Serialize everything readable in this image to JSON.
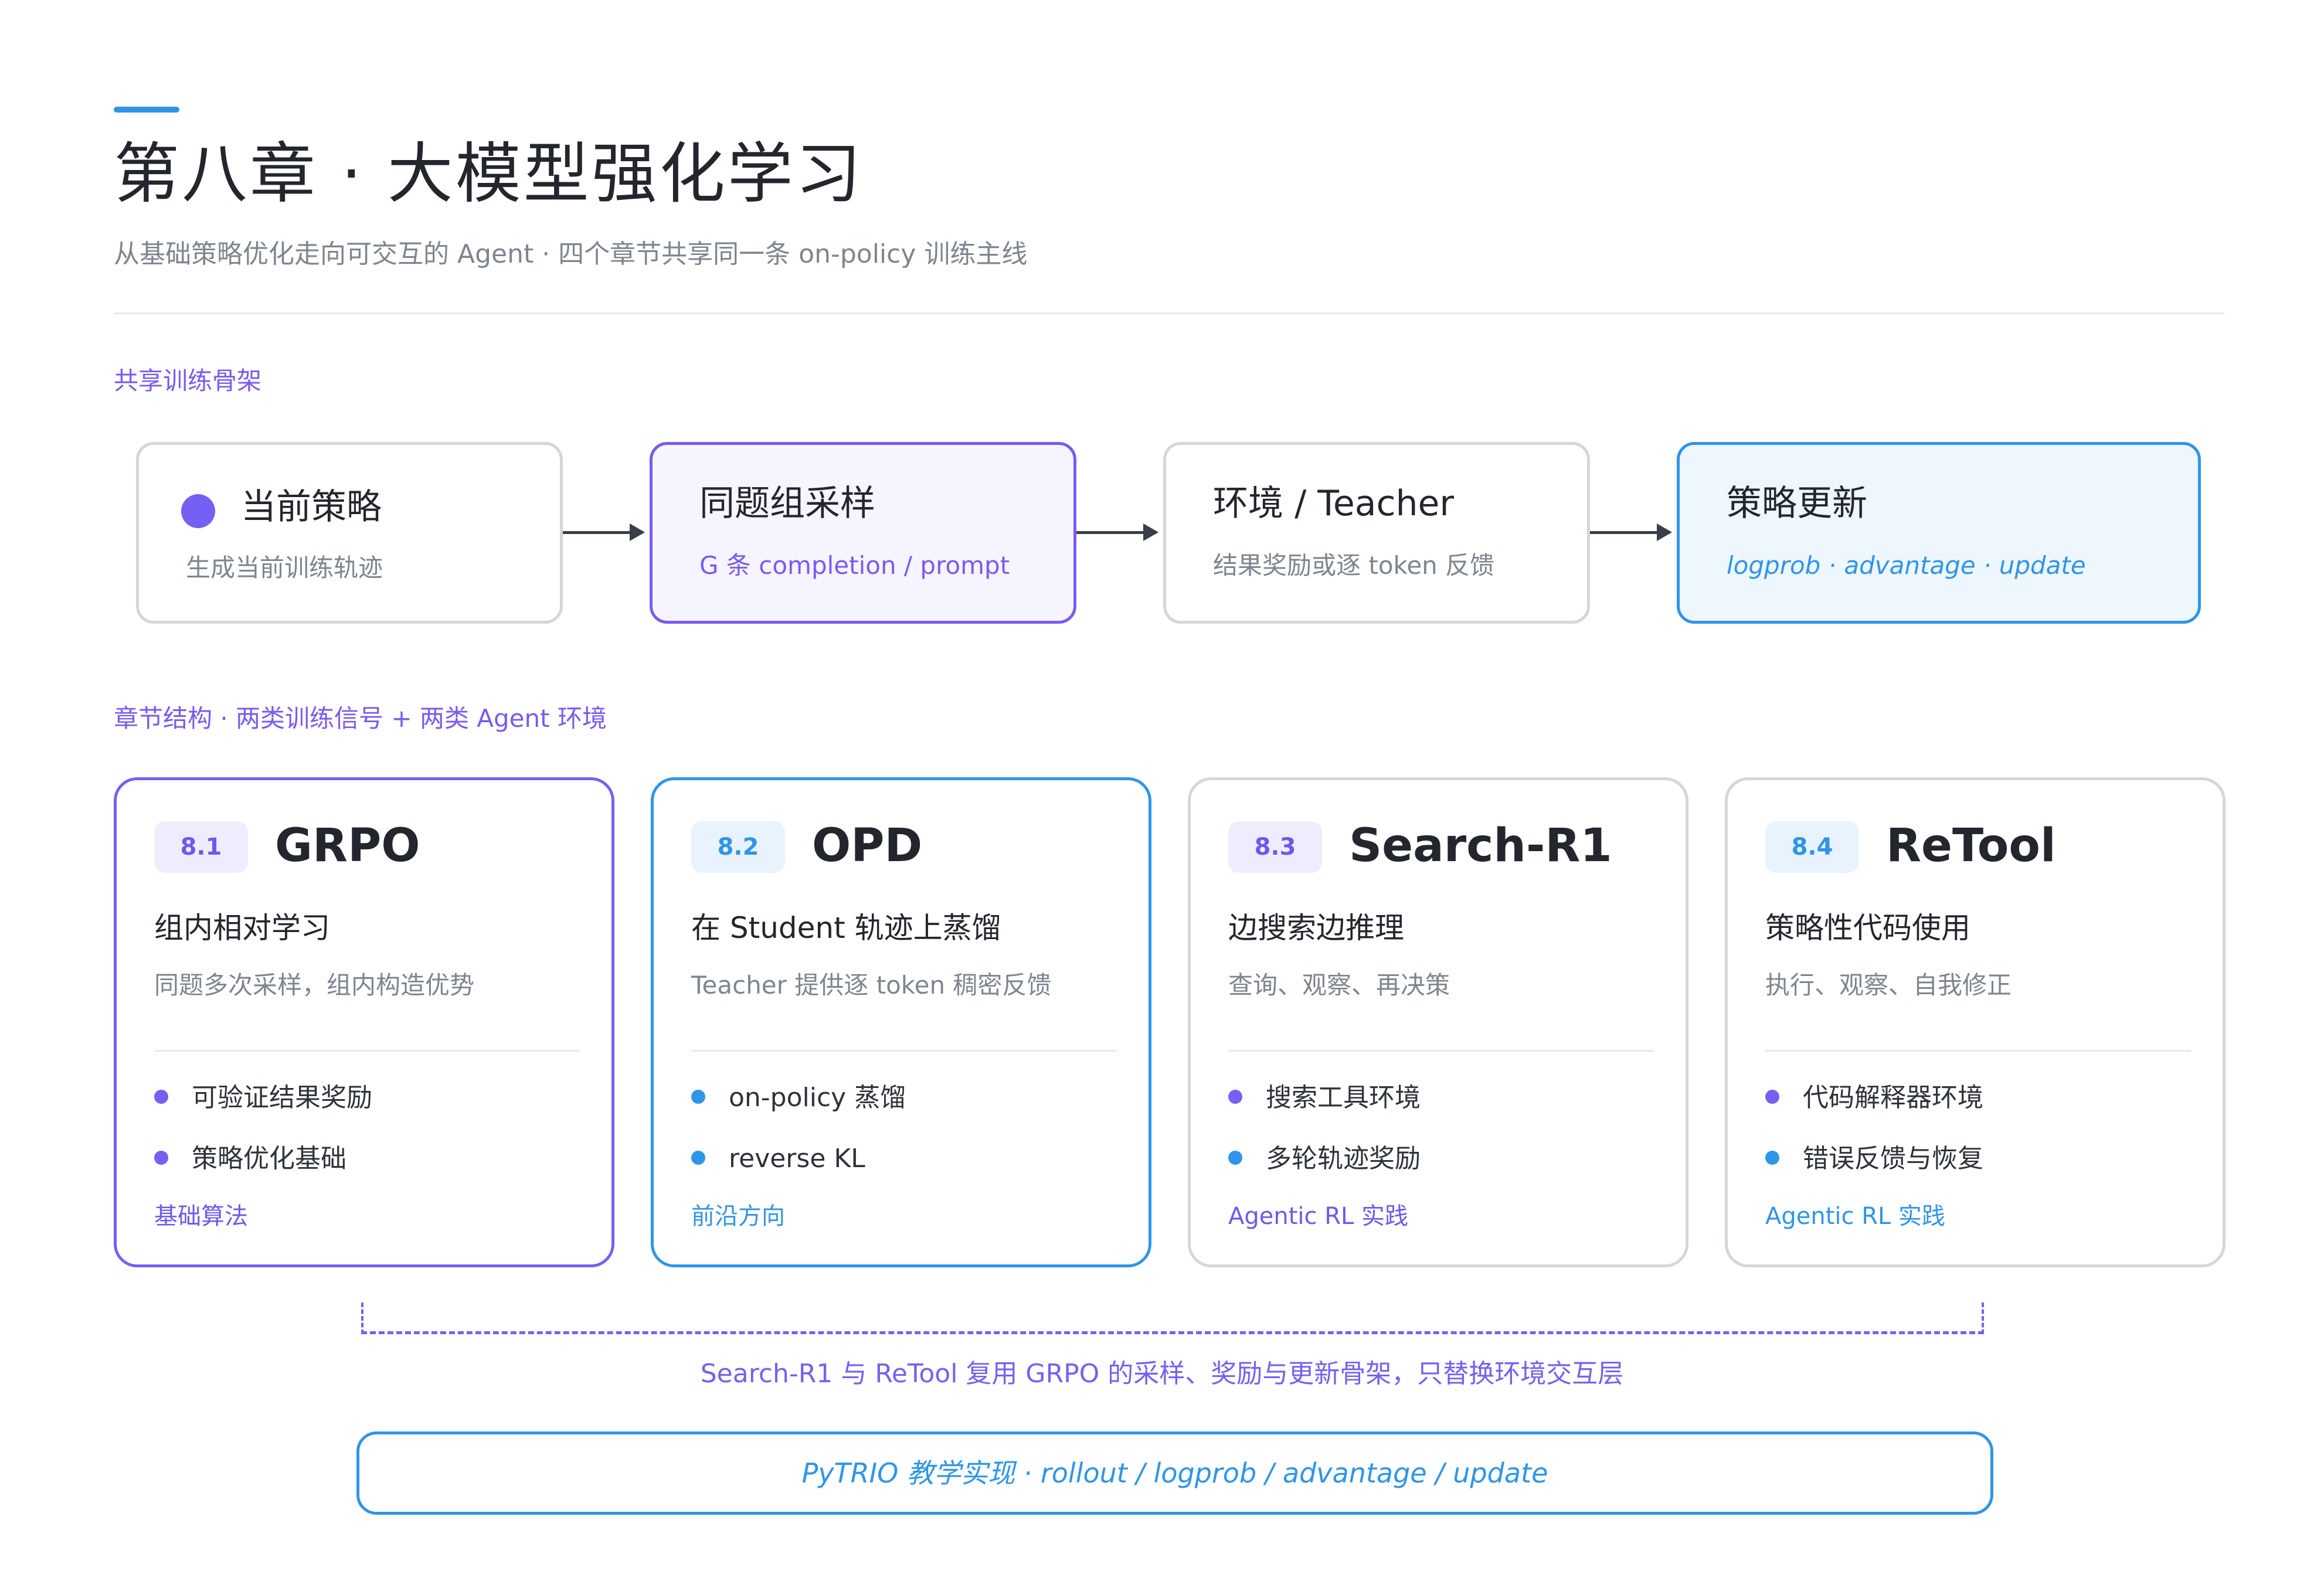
{
  "header": {
    "title": "第八章 · 大模型强化学习",
    "subtitle": "从基础策略优化走向可交互的 Agent · 四个章节共享同一条 on-policy 训练主线"
  },
  "sections": {
    "backbone_label": "共享训练骨架",
    "structure_label": "章节结构 · 两类训练信号 + 两类 Agent 环境"
  },
  "pipeline": [
    {
      "title": "当前策略",
      "sub": "生成当前训练轨迹"
    },
    {
      "title": "同题组采样",
      "sub": "G 条 completion / prompt"
    },
    {
      "title": "环境 / Teacher",
      "sub": "结果奖励或逐 token 反馈"
    },
    {
      "title": "策略更新",
      "sub": "logprob · advantage · update"
    }
  ],
  "chapters": [
    {
      "num": "8.1",
      "title": "GRPO",
      "subtitle": "组内相对学习",
      "desc": "同题多次采样，组内构造优势",
      "items": [
        "可验证结果奖励",
        "策略优化基础"
      ],
      "tag": "基础算法"
    },
    {
      "num": "8.2",
      "title": "OPD",
      "subtitle": "在 Student 轨迹上蒸馏",
      "desc": "Teacher 提供逐 token 稠密反馈",
      "items": [
        "on-policy 蒸馏",
        "reverse KL"
      ],
      "tag": "前沿方向"
    },
    {
      "num": "8.3",
      "title": "Search-R1",
      "subtitle": "边搜索边推理",
      "desc": "查询、观察、再决策",
      "items": [
        "搜索工具环境",
        "多轮轨迹奖励"
      ],
      "tag": "Agentic RL 实践"
    },
    {
      "num": "8.4",
      "title": "ReTool",
      "subtitle": "策略性代码使用",
      "desc": "执行、观察、自我修正",
      "items": [
        "代码解释器环境",
        "错误反馈与恢复"
      ],
      "tag": "Agentic RL 实践"
    }
  ],
  "bracket_note": "Search-R1 与 ReTool 复用 GRPO 的采样、奖励与更新骨架，只替换环境交互层",
  "implementation": "PyTRIO 教学实现 · rollout / logprob / advantage / update",
  "colors": {
    "violet": "#7461f3",
    "blue": "#2f95e8",
    "text": "#23262d",
    "muted": "#7e858e"
  }
}
